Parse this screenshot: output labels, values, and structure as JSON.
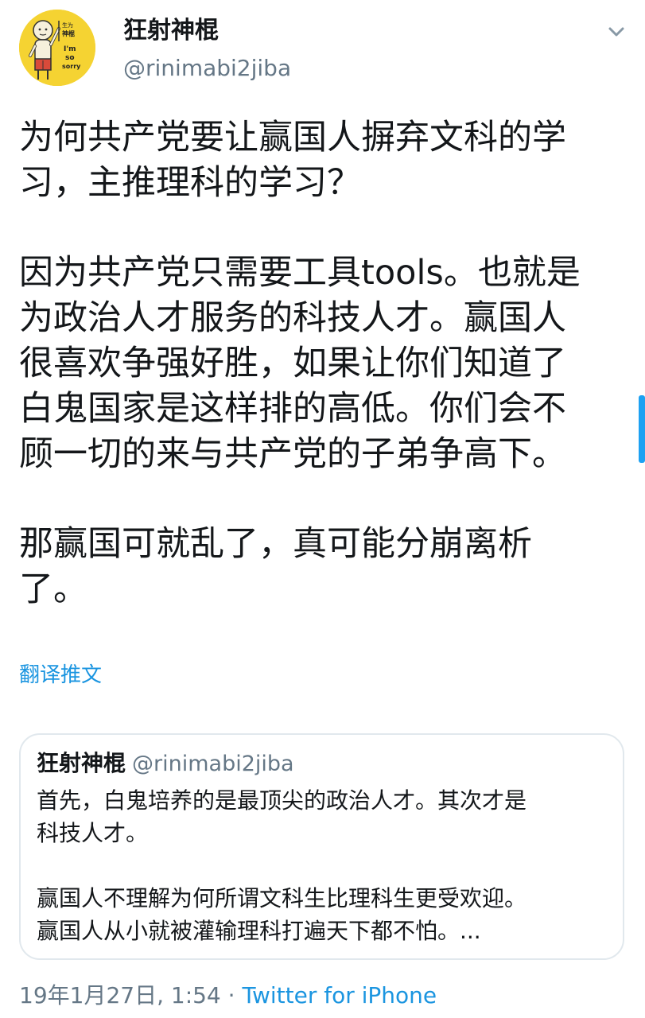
{
  "colors": {
    "link": "#1b95e0",
    "secondary_text": "#657786",
    "primary_text": "#14171a",
    "border": "#e1e8ed",
    "avatar_bg": "#f5d332"
  },
  "author": {
    "display_name": "狂射神棍",
    "handle": "@rinimabi2jiba",
    "avatar_icon": "cartoon-avatar-icon",
    "avatar_text": [
      "生为",
      "神棍",
      "I'm",
      "so",
      "sorry"
    ]
  },
  "menu_icon": "chevron-down-icon",
  "tweet": {
    "paragraphs": [
      "为何共产党要让赢国人摒弃文科的学\n习，主推理科的学习？",
      "因为共产党只需要工具tools。也就是\n为政治人才服务的科技人才。赢国人\n很喜欢争强好胜，如果让你们知道了\n白鬼国家是这样排的高低。你们会不\n顾一切的来与共产党的子弟争高下。",
      "那赢国可就乱了，真可能分崩离析\n了。"
    ],
    "translate_label": "翻译推文"
  },
  "quoted_tweet": {
    "display_name": "狂射神棍",
    "handle": "@rinimabi2jiba",
    "paragraphs": [
      "首先，白鬼培养的是最顶尖的政治人才。其次才是\n科技人才。",
      "赢国人不理解为何所谓文科生比理科生更受欢迎。\n赢国人从小就被灌输理科打遍天下都不怕。..."
    ]
  },
  "meta": {
    "timestamp": "19年1月27日, 1:54",
    "separator": "·",
    "source": "Twitter for iPhone"
  }
}
